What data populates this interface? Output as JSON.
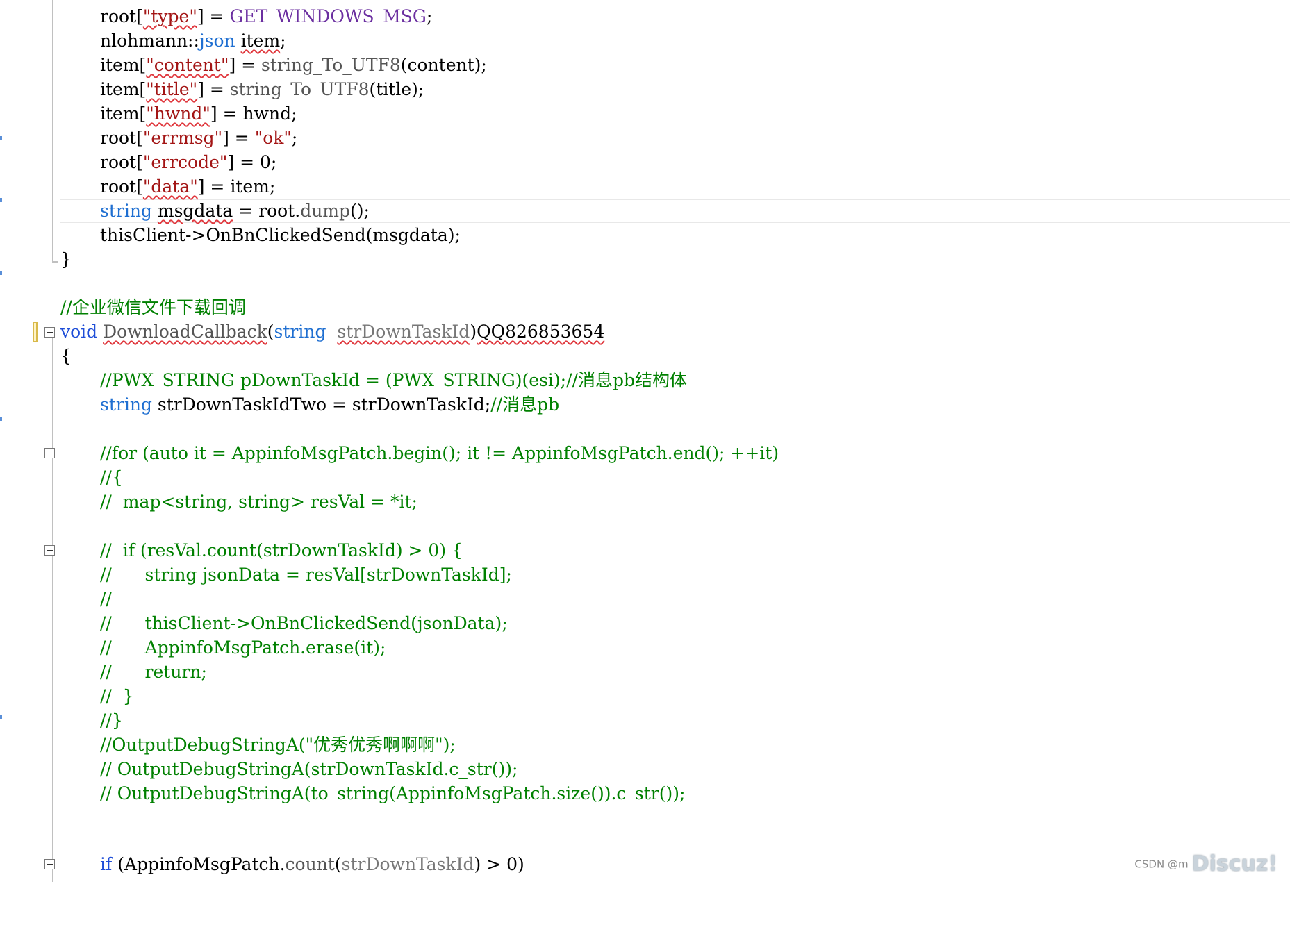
{
  "colors": {
    "keyword": "#1f4ed8",
    "string": "#a31515",
    "comment": "#008000",
    "plain": "#000000",
    "operator": "#555555",
    "member": "#6b2fa0"
  },
  "code_lines": [
    {
      "l": "l1",
      "t1": "root[",
      "t2": "\"type\"",
      "t3": "] = ",
      "t4": "GET_WINDOWS_MSG",
      "t5": ";"
    },
    {
      "l": "l2",
      "t1": "nlohmann::",
      "t2": "json",
      "t3": " ",
      "t4": "item",
      "t5": ";"
    },
    {
      "l": "l3",
      "t1": "item[",
      "t2": "\"content\"",
      "t3": "] = ",
      "t4": "string_To_UTF8",
      "t5": "(content);"
    },
    {
      "l": "l4",
      "t1": "item[",
      "t2": "\"title\"",
      "t3": "] = ",
      "t4": "string_To_UTF8",
      "t5": "(title);"
    },
    {
      "l": "l5",
      "t1": "item[",
      "t2": "\"hwnd\"",
      "t3": "] = hwnd;"
    },
    {
      "l": "l6",
      "t1": "root[",
      "t2": "\"errmsg\"",
      "t3": "] = ",
      "t4": "\"ok\"",
      "t5": ";"
    },
    {
      "l": "l7",
      "t1": "root[",
      "t2": "\"errcode\"",
      "t3": "] = 0;"
    },
    {
      "l": "l8",
      "t1": "root[",
      "t2": "\"data\"",
      "t3": "] = item;"
    },
    {
      "l": "l9",
      "t1": "string",
      "t2": " ",
      "t3": "msgdata",
      "t4": " = root.",
      "t5": "dump",
      "t6": "();"
    },
    {
      "l": "l10",
      "t1": "thisClient->",
      "t2": "OnBnClickedSend",
      "t3": "(msgdata);"
    },
    {
      "l": "l11",
      "t1": "}"
    },
    {
      "l": "l13",
      "t1": "//企业微信文件下载回调"
    },
    {
      "l": "l14",
      "t1": "void",
      "t2": " ",
      "t3": "DownloadCallback",
      "t4": "(",
      "t5": "string",
      "t6": "  ",
      "t7": "strDownTaskId",
      "t8": ")",
      "t9": "QQ826853654"
    },
    {
      "l": "l15",
      "t1": "{"
    },
    {
      "l": "l16",
      "t1": "//PWX_STRING pDownTaskId = (PWX_STRING)(esi);//消息pb结构体"
    },
    {
      "l": "l17",
      "t1": "string",
      "t2": " strDownTaskIdTwo = strDownTaskId;",
      "t3": "//消息pb"
    },
    {
      "l": "l19",
      "t1": "//for (auto it = AppinfoMsgPatch.begin(); it != AppinfoMsgPatch.end(); ++it)"
    },
    {
      "l": "l20",
      "t1": "//{"
    },
    {
      "l": "l21",
      "t1": "//  map<string, string> resVal = *it;"
    },
    {
      "l": "l23",
      "t1": "//  if (resVal.count(strDownTaskId) > 0) {"
    },
    {
      "l": "l24",
      "t1": "//      string jsonData = resVal[strDownTaskId];"
    },
    {
      "l": "l25",
      "t1": "//"
    },
    {
      "l": "l26",
      "t1": "//      thisClient->OnBnClickedSend(jsonData);"
    },
    {
      "l": "l27",
      "t1": "//      AppinfoMsgPatch.erase(it);"
    },
    {
      "l": "l28",
      "t1": "//      return;"
    },
    {
      "l": "l29",
      "t1": "//  }"
    },
    {
      "l": "l30",
      "t1": "//}"
    },
    {
      "l": "l31",
      "t1": "//OutputDebugStringA(\"优秀优秀啊啊啊\");"
    },
    {
      "l": "l32",
      "t1": "// OutputDebugStringA(strDownTaskId.c_str());"
    },
    {
      "l": "l33",
      "t1": "// OutputDebugStringA(to_string(AppinfoMsgPatch.size()).c_str());"
    },
    {
      "l": "l36",
      "t1": "if",
      "t2": " (AppinfoMsgPatch.",
      "t3": "count",
      "t4": "(",
      "t5": "strDownTaskId",
      "t6": ") > 0)"
    }
  ],
  "watermark": {
    "small": "CSDN @m",
    "big": "Discuz!"
  },
  "fold_icon": "collapse-minus-icon"
}
